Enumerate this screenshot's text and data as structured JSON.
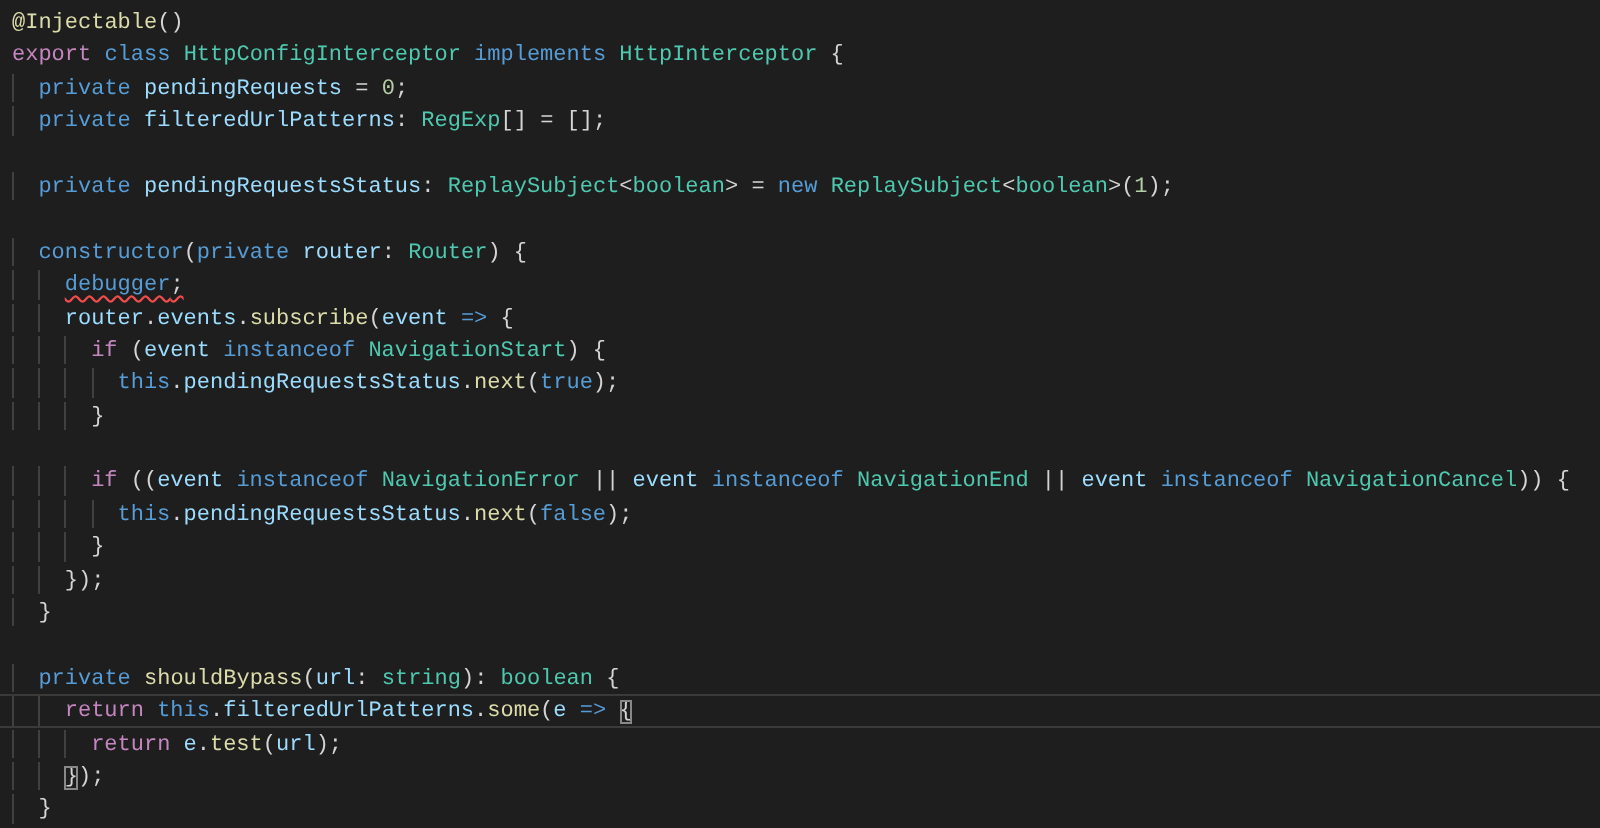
{
  "editor": {
    "lines": [
      {
        "current": false,
        "tokens": [
          {
            "kind": "fn",
            "t": "@Injectable"
          },
          {
            "kind": "punc",
            "t": "()"
          }
        ]
      },
      {
        "current": false,
        "tokens": [
          {
            "kind": "ctl",
            "t": "export"
          },
          {
            "kind": "kw",
            "t": " class"
          },
          {
            "kind": "type",
            "t": " HttpConfigInterceptor"
          },
          {
            "kind": "kw",
            "t": " implements"
          },
          {
            "kind": "type",
            "t": " HttpInterceptor"
          },
          {
            "kind": "punc",
            "t": " {"
          }
        ]
      },
      {
        "current": false,
        "tokens": [
          {
            "kind": "kw",
            "t": "  private"
          },
          {
            "kind": "var",
            "t": " pendingRequests"
          },
          {
            "kind": "punc",
            "t": " ="
          },
          {
            "kind": "num",
            "t": " 0"
          },
          {
            "kind": "punc",
            "t": ";"
          }
        ]
      },
      {
        "current": false,
        "tokens": [
          {
            "kind": "kw",
            "t": "  private"
          },
          {
            "kind": "var",
            "t": " filteredUrlPatterns"
          },
          {
            "kind": "punc",
            "t": ":"
          },
          {
            "kind": "type",
            "t": " RegExp"
          },
          {
            "kind": "punc",
            "t": "[] = [];"
          }
        ]
      },
      {
        "current": false
      },
      {
        "current": false,
        "tokens": [
          {
            "kind": "kw",
            "t": "  private"
          },
          {
            "kind": "var",
            "t": " pendingRequestsStatus"
          },
          {
            "kind": "punc",
            "t": ":"
          },
          {
            "kind": "type",
            "t": " ReplaySubject"
          },
          {
            "kind": "punc",
            "t": "<"
          },
          {
            "kind": "type",
            "t": "boolean"
          },
          {
            "kind": "punc",
            "t": "> ="
          },
          {
            "kind": "kw",
            "t": " new"
          },
          {
            "kind": "type",
            "t": " ReplaySubject"
          },
          {
            "kind": "punc",
            "t": "<"
          },
          {
            "kind": "type",
            "t": "boolean"
          },
          {
            "kind": "punc",
            "t": ">("
          },
          {
            "kind": "num",
            "t": "1"
          },
          {
            "kind": "punc",
            "t": ");"
          }
        ]
      },
      {
        "current": false
      },
      {
        "current": false,
        "tokens": [
          {
            "kind": "kw",
            "t": "  constructor"
          },
          {
            "kind": "punc",
            "t": "("
          },
          {
            "kind": "kw",
            "t": "private"
          },
          {
            "kind": "var",
            "t": " router"
          },
          {
            "kind": "punc",
            "t": ":"
          },
          {
            "kind": "type",
            "t": " Router"
          },
          {
            "kind": "punc",
            "t": ") {"
          }
        ]
      },
      {
        "current": false,
        "tokens": [
          {
            "kind": "kw",
            "t": "    debugger",
            "squiggle": true
          },
          {
            "kind": "punc",
            "t": ";",
            "squiggle": true
          }
        ]
      },
      {
        "current": false,
        "tokens": [
          {
            "kind": "var",
            "t": "    router"
          },
          {
            "kind": "punc",
            "t": "."
          },
          {
            "kind": "var",
            "t": "events"
          },
          {
            "kind": "punc",
            "t": "."
          },
          {
            "kind": "fn",
            "t": "subscribe"
          },
          {
            "kind": "punc",
            "t": "("
          },
          {
            "kind": "var",
            "t": "event"
          },
          {
            "kind": "kw",
            "t": " =>"
          },
          {
            "kind": "punc",
            "t": " {"
          }
        ]
      },
      {
        "current": false,
        "tokens": [
          {
            "kind": "ctl",
            "t": "      if"
          },
          {
            "kind": "punc",
            "t": " ("
          },
          {
            "kind": "var",
            "t": "event"
          },
          {
            "kind": "kw",
            "t": " instanceof"
          },
          {
            "kind": "type",
            "t": " NavigationStart"
          },
          {
            "kind": "punc",
            "t": ") {"
          }
        ]
      },
      {
        "current": false,
        "tokens": [
          {
            "kind": "kw",
            "t": "        this"
          },
          {
            "kind": "punc",
            "t": "."
          },
          {
            "kind": "var",
            "t": "pendingRequestsStatus"
          },
          {
            "kind": "punc",
            "t": "."
          },
          {
            "kind": "fn",
            "t": "next"
          },
          {
            "kind": "punc",
            "t": "("
          },
          {
            "kind": "kw",
            "t": "true"
          },
          {
            "kind": "punc",
            "t": ");"
          }
        ]
      },
      {
        "current": false,
        "tokens": [
          {
            "kind": "punc",
            "t": "      }"
          }
        ]
      },
      {
        "current": false
      },
      {
        "current": false,
        "tokens": [
          {
            "kind": "ctl",
            "t": "      if"
          },
          {
            "kind": "punc",
            "t": " (("
          },
          {
            "kind": "var",
            "t": "event"
          },
          {
            "kind": "kw",
            "t": " instanceof"
          },
          {
            "kind": "type",
            "t": " NavigationError"
          },
          {
            "kind": "punc",
            "t": " ||"
          },
          {
            "kind": "var",
            "t": " event"
          },
          {
            "kind": "kw",
            "t": " instanceof"
          },
          {
            "kind": "type",
            "t": " NavigationEnd"
          },
          {
            "kind": "punc",
            "t": " ||"
          },
          {
            "kind": "var",
            "t": " event"
          },
          {
            "kind": "kw",
            "t": " instanceof"
          },
          {
            "kind": "type",
            "t": " NavigationCancel"
          },
          {
            "kind": "punc",
            "t": ")) {"
          }
        ]
      },
      {
        "current": false,
        "tokens": [
          {
            "kind": "kw",
            "t": "        this"
          },
          {
            "kind": "punc",
            "t": "."
          },
          {
            "kind": "var",
            "t": "pendingRequestsStatus"
          },
          {
            "kind": "punc",
            "t": "."
          },
          {
            "kind": "fn",
            "t": "next"
          },
          {
            "kind": "punc",
            "t": "("
          },
          {
            "kind": "kw",
            "t": "false"
          },
          {
            "kind": "punc",
            "t": ");"
          }
        ]
      },
      {
        "current": false,
        "tokens": [
          {
            "kind": "punc",
            "t": "      }"
          }
        ]
      },
      {
        "current": false,
        "tokens": [
          {
            "kind": "punc",
            "t": "    });"
          }
        ]
      },
      {
        "current": false,
        "tokens": [
          {
            "kind": "punc",
            "t": "  }"
          }
        ]
      },
      {
        "current": false
      },
      {
        "current": false,
        "tokens": [
          {
            "kind": "kw",
            "t": "  private"
          },
          {
            "kind": "fn",
            "t": " shouldBypass"
          },
          {
            "kind": "punc",
            "t": "("
          },
          {
            "kind": "var",
            "t": "url"
          },
          {
            "kind": "punc",
            "t": ":"
          },
          {
            "kind": "type",
            "t": " string"
          },
          {
            "kind": "punc",
            "t": "):"
          },
          {
            "kind": "type",
            "t": " boolean"
          },
          {
            "kind": "punc",
            "t": " {"
          }
        ]
      },
      {
        "current": true,
        "tokens": [
          {
            "kind": "ctl",
            "t": "    return"
          },
          {
            "kind": "kw",
            "t": " this"
          },
          {
            "kind": "punc",
            "t": "."
          },
          {
            "kind": "var",
            "t": "filteredUrlPatterns"
          },
          {
            "kind": "punc",
            "t": "."
          },
          {
            "kind": "fn",
            "t": "some"
          },
          {
            "kind": "punc",
            "t": "("
          },
          {
            "kind": "var",
            "t": "e"
          },
          {
            "kind": "kw",
            "t": " =>"
          },
          {
            "kind": "punc",
            "t": " {",
            "match": true
          }
        ]
      },
      {
        "current": false,
        "tokens": [
          {
            "kind": "ctl",
            "t": "      return"
          },
          {
            "kind": "var",
            "t": " e"
          },
          {
            "kind": "punc",
            "t": "."
          },
          {
            "kind": "fn",
            "t": "test"
          },
          {
            "kind": "punc",
            "t": "("
          },
          {
            "kind": "var",
            "t": "url"
          },
          {
            "kind": "punc",
            "t": ");"
          }
        ]
      },
      {
        "current": false,
        "tokens": [
          {
            "kind": "punc",
            "t": "    }",
            "match": true
          },
          {
            "kind": "punc",
            "t": ");"
          }
        ]
      },
      {
        "current": false,
        "tokens": [
          {
            "kind": "punc",
            "t": "  }"
          }
        ]
      }
    ]
  }
}
